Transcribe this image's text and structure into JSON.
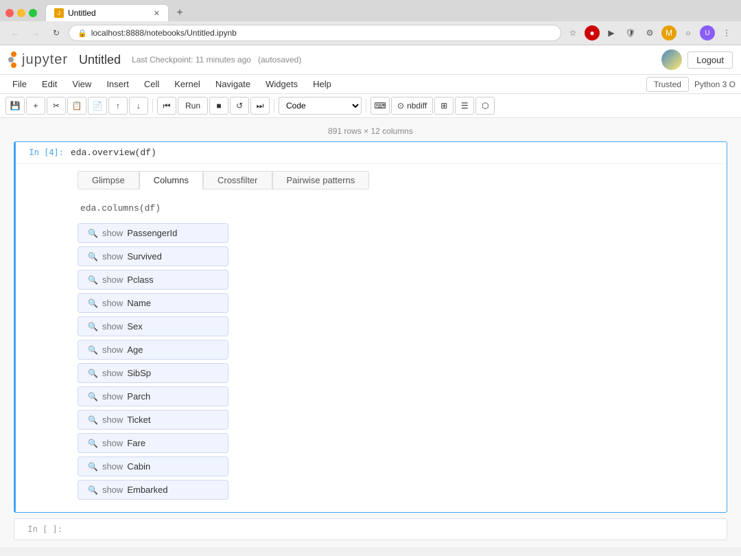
{
  "browser": {
    "tab_title": "Untitled",
    "url": "localhost:8888/notebooks/Untitled.ipynb",
    "new_tab_label": "+",
    "nav": {
      "back": "←",
      "forward": "→",
      "refresh": "↻"
    }
  },
  "jupyter": {
    "logo_text": "jupyter",
    "notebook_title": "Untitled",
    "checkpoint_text": "Last Checkpoint: 11 minutes ago",
    "autosaved_text": "(autosaved)",
    "logout_label": "Logout"
  },
  "menu": {
    "items": [
      "File",
      "Edit",
      "View",
      "Insert",
      "Cell",
      "Kernel",
      "Navigate",
      "Widgets",
      "Help"
    ],
    "trusted_label": "Trusted",
    "kernel_info": "Python 3 O"
  },
  "toolbar": {
    "run_label": "Run",
    "cell_type": "Code",
    "nbdiff_label": "nbdiff"
  },
  "notebook": {
    "row_info": "891 rows × 12 columns",
    "cell1": {
      "prompt": "In [4]:",
      "code": "eda.overview(df)"
    },
    "cell2": {
      "prompt": "In [ ]:",
      "code": ""
    }
  },
  "output": {
    "tabs": [
      "Glimpse",
      "Columns",
      "Crossfilter",
      "Pairwise patterns"
    ],
    "active_tab": "Columns",
    "columns_title": "eda.columns(df)",
    "columns": [
      "PassengerId",
      "Survived",
      "Pclass",
      "Name",
      "Sex",
      "Age",
      "SibSp",
      "Parch",
      "Ticket",
      "Fare",
      "Cabin",
      "Embarked"
    ],
    "show_label": "show"
  }
}
